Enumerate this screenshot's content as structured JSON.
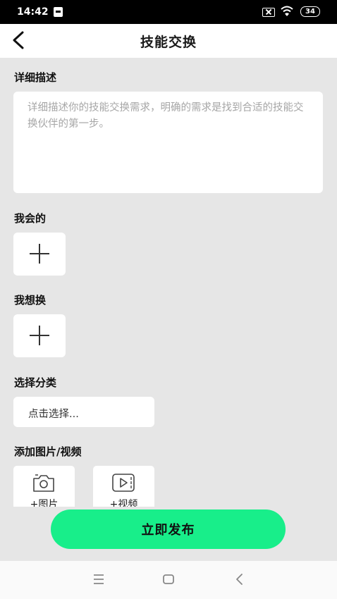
{
  "status_bar": {
    "time": "14:42",
    "battery": "34"
  },
  "header": {
    "title": "技能交换"
  },
  "description": {
    "label": "详细描述",
    "value": "",
    "placeholder": "详细描述你的技能交换需求，明确的需求是找到合适的技能交换伙伴的第一步。"
  },
  "skills_have": {
    "label": "我会的"
  },
  "skills_want": {
    "label": "我想换"
  },
  "category": {
    "label": "选择分类",
    "value": "点击选择..."
  },
  "media": {
    "label": "添加图片/视频",
    "image_label": "+图片",
    "video_label": "+视频"
  },
  "submit": {
    "label": "立即发布"
  },
  "colors": {
    "accent": "#18ee8a",
    "background": "#e6e6e6",
    "card": "#ffffff",
    "placeholder": "#a6a6a6"
  },
  "icons": {
    "back": "chevron-left-icon",
    "add": "plus-icon",
    "camera": "camera-icon",
    "video": "video-icon",
    "nav_menu": "menu-icon",
    "nav_home": "home-square-icon",
    "nav_back": "back-chevron-icon"
  }
}
